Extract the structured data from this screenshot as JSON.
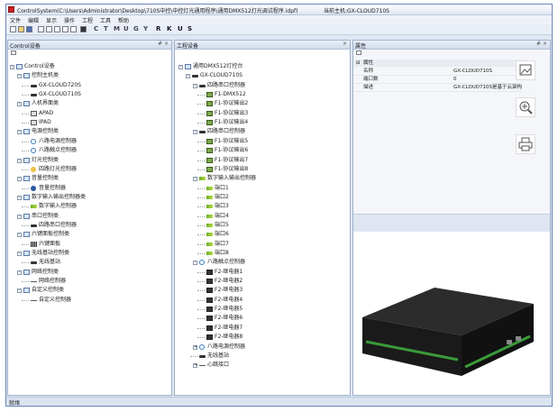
{
  "window": {
    "title": "ControlSystem(C:\\Users\\Administrator\\Desktop\\710S中控\\中控灯光通用程序\\通用DMX512灯光调试程序.idpf)",
    "host": "当前主机:GX-CLOUD710S"
  },
  "menu": [
    "文件",
    "编辑",
    "显示",
    "操作",
    "工程",
    "工具",
    "帮助"
  ],
  "toolbar": {
    "letters": [
      "C",
      "T",
      "M",
      "U",
      "G",
      "Y",
      "R",
      "K",
      "U",
      "S"
    ]
  },
  "left_panel": {
    "title": "Control设备",
    "pin": "# ×",
    "tree": [
      {
        "label": "Control设备",
        "icon": "pc",
        "level": 0,
        "exp": "-"
      },
      {
        "label": "控制主机类",
        "icon": "pc",
        "level": 1,
        "exp": "-"
      },
      {
        "label": "GX-CLOUD720S",
        "icon": "dev",
        "level": 2
      },
      {
        "label": "GX-CLOUD710S",
        "icon": "dev",
        "level": 2
      },
      {
        "label": "人机界面类",
        "icon": "pc",
        "level": 1,
        "exp": "-"
      },
      {
        "label": "APAD",
        "icon": "tab",
        "level": 2
      },
      {
        "label": "IPAD",
        "icon": "tab",
        "level": 2
      },
      {
        "label": "电源控制类",
        "icon": "pc",
        "level": 1,
        "exp": "-"
      },
      {
        "label": "八路电源控制器",
        "icon": "clock",
        "level": 2
      },
      {
        "label": "八路触点控制器",
        "icon": "clock",
        "level": 2
      },
      {
        "label": "灯光控制类",
        "icon": "pc",
        "level": 1,
        "exp": "-"
      },
      {
        "label": "四路灯光控制器",
        "icon": "bulb",
        "level": 2
      },
      {
        "label": "音量控制类",
        "icon": "pc",
        "level": 1,
        "exp": "-"
      },
      {
        "label": "音量控制器",
        "icon": "spk",
        "level": 2
      },
      {
        "label": "数字输入输出控制器类",
        "icon": "pc",
        "level": 1,
        "exp": "-"
      },
      {
        "label": "数字输入控制器",
        "icon": "arrow",
        "level": 2
      },
      {
        "label": "串口控制类",
        "icon": "pc",
        "level": 1,
        "exp": "-"
      },
      {
        "label": "四路串口控制器",
        "icon": "dev",
        "level": 2
      },
      {
        "label": "六键面板控制类",
        "icon": "pc",
        "level": 1,
        "exp": "-"
      },
      {
        "label": "六键面板",
        "icon": "grid",
        "level": 2
      },
      {
        "label": "无线基站控制类",
        "icon": "pc",
        "level": 1,
        "exp": "-"
      },
      {
        "label": "无线基站",
        "icon": "dev",
        "level": 2
      },
      {
        "label": "网络控制类",
        "icon": "pc",
        "level": 1,
        "exp": "-"
      },
      {
        "label": "网络控制器",
        "icon": "line",
        "level": 2
      },
      {
        "label": "自定义控制类",
        "icon": "pc",
        "level": 1,
        "exp": "-"
      },
      {
        "label": "自定义控制器",
        "icon": "line",
        "level": 2
      }
    ]
  },
  "mid_panel": {
    "title": "工程设备",
    "pin": "×",
    "tree": [
      {
        "label": "通用DMX512灯控台",
        "icon": "pc",
        "level": 0,
        "exp": "-"
      },
      {
        "label": "GX-CLOUD710S",
        "icon": "dev",
        "level": 1,
        "exp": "-"
      },
      {
        "label": "四路串口控制器",
        "icon": "dev",
        "level": 2,
        "exp": "-"
      },
      {
        "label": "F1-DMX512",
        "icon": "green",
        "level": 3
      },
      {
        "label": "F1-协议输出2",
        "icon": "green",
        "level": 3
      },
      {
        "label": "F1-协议输出3",
        "icon": "green",
        "level": 3
      },
      {
        "label": "F1-协议输出4",
        "icon": "green",
        "level": 3
      },
      {
        "label": "四路串口控制器",
        "icon": "dev",
        "level": 2,
        "exp": "-"
      },
      {
        "label": "F1-协议输出5",
        "icon": "green",
        "level": 3
      },
      {
        "label": "F1-协议输出6",
        "icon": "green",
        "level": 3
      },
      {
        "label": "F1-协议输出7",
        "icon": "green",
        "level": 3
      },
      {
        "label": "F1-协议输出8",
        "icon": "green",
        "level": 3
      },
      {
        "label": "数字输入输出控制器",
        "icon": "arrow",
        "level": 2,
        "exp": "-"
      },
      {
        "label": "端口1",
        "icon": "arrow",
        "level": 3
      },
      {
        "label": "端口2",
        "icon": "arrow",
        "level": 3
      },
      {
        "label": "端口3",
        "icon": "arrow",
        "level": 3
      },
      {
        "label": "端口4",
        "icon": "arrow",
        "level": 3
      },
      {
        "label": "端口5",
        "icon": "arrow",
        "level": 3
      },
      {
        "label": "端口6",
        "icon": "arrow",
        "level": 3
      },
      {
        "label": "端口7",
        "icon": "arrow",
        "level": 3
      },
      {
        "label": "端口8",
        "icon": "arrow",
        "level": 3
      },
      {
        "label": "八路触点控制器",
        "icon": "clock",
        "level": 2,
        "exp": "-"
      },
      {
        "label": "F2-继电器1",
        "icon": "relay",
        "level": 3
      },
      {
        "label": "F2-继电器2",
        "icon": "relay",
        "level": 3
      },
      {
        "label": "F2-继电器3",
        "icon": "relay",
        "level": 3
      },
      {
        "label": "F2-继电器4",
        "icon": "relay",
        "level": 3
      },
      {
        "label": "F2-继电器5",
        "icon": "relay",
        "level": 3
      },
      {
        "label": "F2-继电器6",
        "icon": "relay",
        "level": 3
      },
      {
        "label": "F2-继电器7",
        "icon": "relay",
        "level": 3
      },
      {
        "label": "F2-继电器8",
        "icon": "relay",
        "level": 3
      },
      {
        "label": "八路电源控制器",
        "icon": "clock",
        "level": 2,
        "exp": "+"
      },
      {
        "label": "无线基站",
        "icon": "dev",
        "level": 2
      },
      {
        "label": "心跳接口",
        "icon": "line",
        "level": 2,
        "exp": "+"
      }
    ]
  },
  "props": {
    "title": "属性",
    "pin": "# ×",
    "section": "属性",
    "rows": [
      {
        "k": "名称",
        "v": "GX-CLOUD710S"
      },
      {
        "k": "端口数",
        "v": "0"
      },
      {
        "k": "描述",
        "v": "GX-CLOUD710S是基于云架构的中央控制主机"
      }
    ]
  },
  "floating": [
    "image-icon",
    "zoom-in-icon",
    "print-icon"
  ],
  "status": "就绪"
}
